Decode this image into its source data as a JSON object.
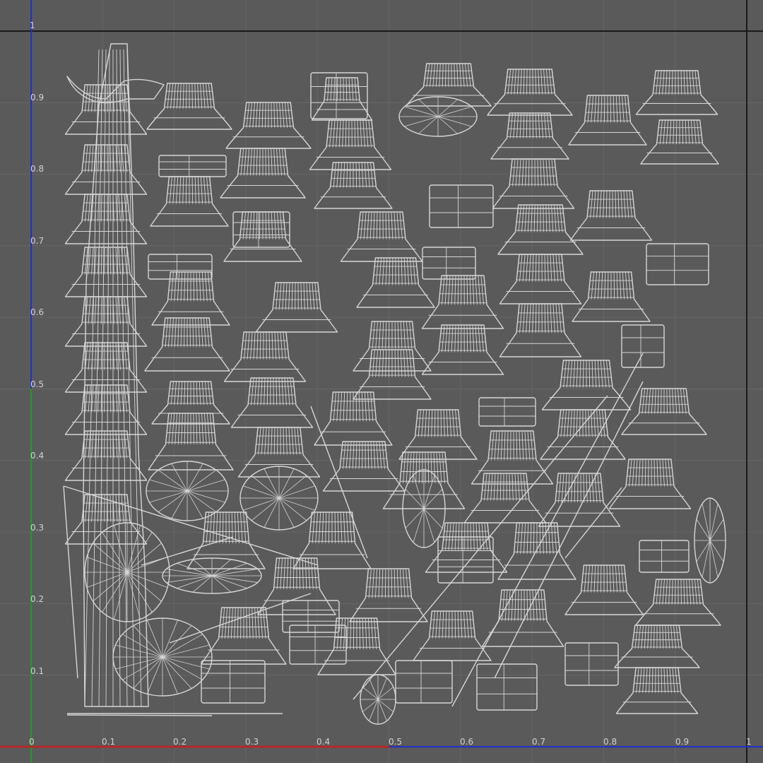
{
  "editor": {
    "colors": {
      "background": "#5a5a5a",
      "grid": "#666666",
      "boundary": "#1a1a1a",
      "wireframe": "#d6d6d6",
      "u_axis": "#c81e1e",
      "v_axis": "#1e9e1e",
      "u_axis_extension": "#2030c8",
      "v_axis_extension": "#2030c8"
    },
    "u_ticks": [
      "0",
      "0.1",
      "0.2",
      "0.3",
      "0.4",
      "0.5",
      "0.6",
      "0.7",
      "0.8",
      "0.9",
      "1"
    ],
    "v_ticks": [
      "0.9",
      "0.8",
      "0.7",
      "0.6",
      "0.5",
      "0.4",
      "0.3",
      "0.2",
      "0.1"
    ],
    "v_top_label": "1",
    "grid_visible": true,
    "shell_icon": "uv-shell-wireframe"
  }
}
